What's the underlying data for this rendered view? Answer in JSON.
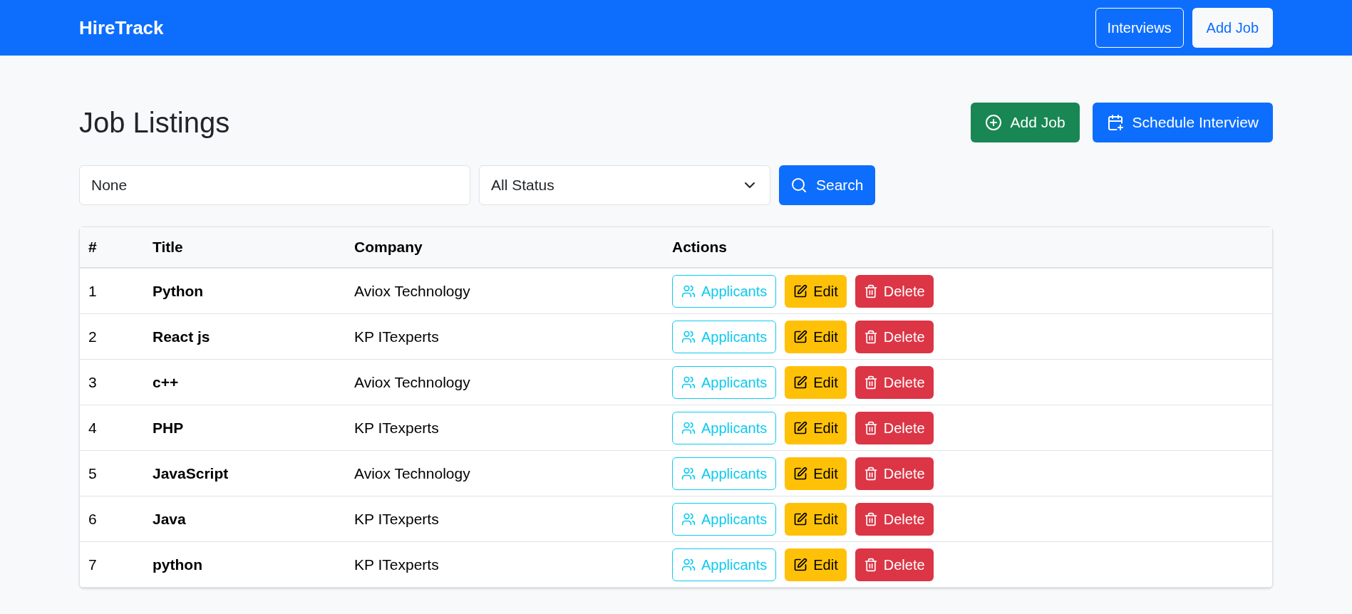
{
  "navbar": {
    "brand": "HireTrack",
    "links": [
      "Interviews",
      "Add Job"
    ]
  },
  "header": {
    "title": "Job Listings",
    "buttons": [
      {
        "kind": "add",
        "label": "Add Job"
      },
      {
        "kind": "schedule",
        "label": "Schedule Interview"
      }
    ]
  },
  "filters": {
    "search_value": "None",
    "status": "All Status",
    "search_button": "Search"
  },
  "table": {
    "columns": [
      "#",
      "Title",
      "Company",
      "Actions"
    ],
    "rows": [
      {
        "number": "1",
        "title": "Python",
        "company": "Aviox Technology",
        "actions": [
          "Applicants",
          "Edit",
          "Delete"
        ]
      },
      {
        "number": "2",
        "title": "React js",
        "company": "KP ITexperts",
        "actions": [
          "Applicants",
          "Edit",
          "Delete"
        ]
      },
      {
        "number": "3",
        "title": "c++",
        "company": "Aviox Technology",
        "actions": [
          "Applicants",
          "Edit",
          "Delete"
        ]
      },
      {
        "number": "4",
        "title": "PHP",
        "company": "KP ITexperts",
        "actions": [
          "Applicants",
          "Edit",
          "Delete"
        ]
      },
      {
        "number": "5",
        "title": "JavaScript",
        "company": "Aviox Technology",
        "actions": [
          "Applicants",
          "Edit",
          "Delete"
        ]
      },
      {
        "number": "6",
        "title": "Java",
        "company": "KP ITexperts",
        "actions": [
          "Applicants",
          "Edit",
          "Delete"
        ]
      },
      {
        "number": "7",
        "title": "python",
        "company": "KP ITexperts",
        "actions": [
          "Applicants",
          "Edit",
          "Delete"
        ]
      }
    ]
  }
}
